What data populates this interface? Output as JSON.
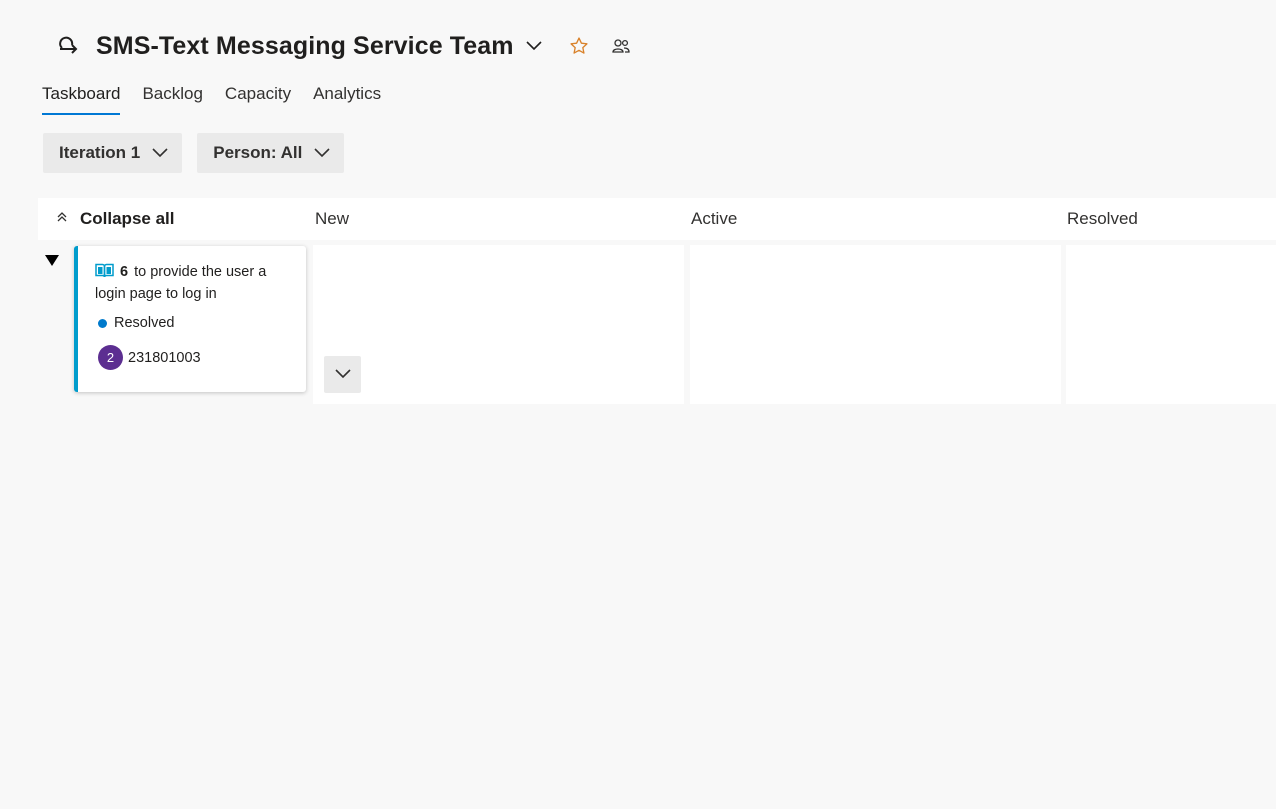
{
  "header": {
    "team_title": "SMS-Text Messaging Service Team",
    "icons": [
      "sprint-icon",
      "chevron-down-icon",
      "star-icon",
      "team-members-icon"
    ],
    "favorite_color": "#d9822b"
  },
  "tabs": [
    {
      "label": "Taskboard",
      "active": true
    },
    {
      "label": "Backlog",
      "active": false
    },
    {
      "label": "Capacity",
      "active": false
    },
    {
      "label": "Analytics",
      "active": false
    }
  ],
  "filters": {
    "iteration": "Iteration 1",
    "person": "Person: All"
  },
  "board": {
    "collapse_all_label": "Collapse all",
    "columns": [
      "New",
      "Active",
      "Resolved"
    ]
  },
  "card": {
    "id": "6",
    "title": "to provide the user a login page to log in",
    "state": "Resolved",
    "state_color": "#007acc",
    "accent_color": "#009ccc",
    "avatar_initial": "2",
    "avatar_color": "#5c2e91",
    "assignee": "231801003"
  }
}
